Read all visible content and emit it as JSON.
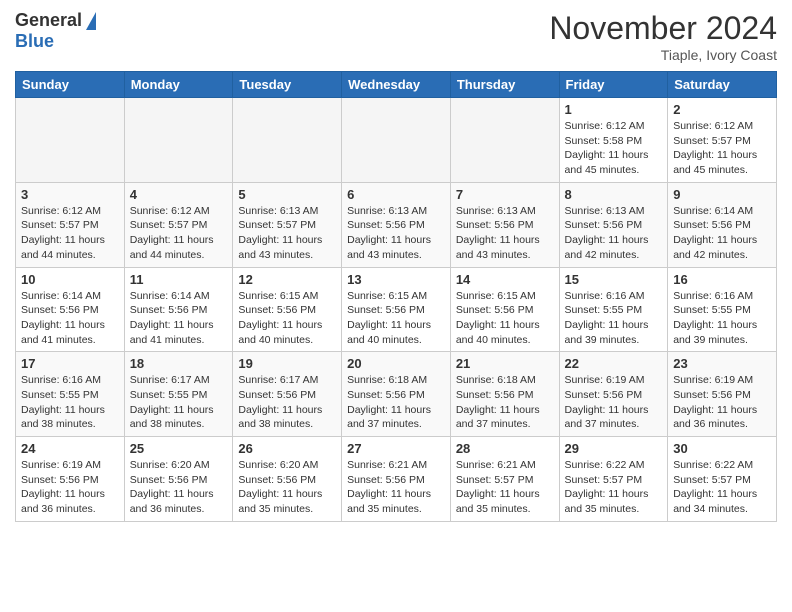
{
  "header": {
    "logo_general": "General",
    "logo_blue": "Blue",
    "month_title": "November 2024",
    "location": "Tiaple, Ivory Coast"
  },
  "weekdays": [
    "Sunday",
    "Monday",
    "Tuesday",
    "Wednesday",
    "Thursday",
    "Friday",
    "Saturday"
  ],
  "weeks": [
    [
      {
        "day": "",
        "info": ""
      },
      {
        "day": "",
        "info": ""
      },
      {
        "day": "",
        "info": ""
      },
      {
        "day": "",
        "info": ""
      },
      {
        "day": "",
        "info": ""
      },
      {
        "day": "1",
        "info": "Sunrise: 6:12 AM\nSunset: 5:58 PM\nDaylight: 11 hours and 45 minutes."
      },
      {
        "day": "2",
        "info": "Sunrise: 6:12 AM\nSunset: 5:57 PM\nDaylight: 11 hours and 45 minutes."
      }
    ],
    [
      {
        "day": "3",
        "info": "Sunrise: 6:12 AM\nSunset: 5:57 PM\nDaylight: 11 hours and 44 minutes."
      },
      {
        "day": "4",
        "info": "Sunrise: 6:12 AM\nSunset: 5:57 PM\nDaylight: 11 hours and 44 minutes."
      },
      {
        "day": "5",
        "info": "Sunrise: 6:13 AM\nSunset: 5:57 PM\nDaylight: 11 hours and 43 minutes."
      },
      {
        "day": "6",
        "info": "Sunrise: 6:13 AM\nSunset: 5:56 PM\nDaylight: 11 hours and 43 minutes."
      },
      {
        "day": "7",
        "info": "Sunrise: 6:13 AM\nSunset: 5:56 PM\nDaylight: 11 hours and 43 minutes."
      },
      {
        "day": "8",
        "info": "Sunrise: 6:13 AM\nSunset: 5:56 PM\nDaylight: 11 hours and 42 minutes."
      },
      {
        "day": "9",
        "info": "Sunrise: 6:14 AM\nSunset: 5:56 PM\nDaylight: 11 hours and 42 minutes."
      }
    ],
    [
      {
        "day": "10",
        "info": "Sunrise: 6:14 AM\nSunset: 5:56 PM\nDaylight: 11 hours and 41 minutes."
      },
      {
        "day": "11",
        "info": "Sunrise: 6:14 AM\nSunset: 5:56 PM\nDaylight: 11 hours and 41 minutes."
      },
      {
        "day": "12",
        "info": "Sunrise: 6:15 AM\nSunset: 5:56 PM\nDaylight: 11 hours and 40 minutes."
      },
      {
        "day": "13",
        "info": "Sunrise: 6:15 AM\nSunset: 5:56 PM\nDaylight: 11 hours and 40 minutes."
      },
      {
        "day": "14",
        "info": "Sunrise: 6:15 AM\nSunset: 5:56 PM\nDaylight: 11 hours and 40 minutes."
      },
      {
        "day": "15",
        "info": "Sunrise: 6:16 AM\nSunset: 5:55 PM\nDaylight: 11 hours and 39 minutes."
      },
      {
        "day": "16",
        "info": "Sunrise: 6:16 AM\nSunset: 5:55 PM\nDaylight: 11 hours and 39 minutes."
      }
    ],
    [
      {
        "day": "17",
        "info": "Sunrise: 6:16 AM\nSunset: 5:55 PM\nDaylight: 11 hours and 38 minutes."
      },
      {
        "day": "18",
        "info": "Sunrise: 6:17 AM\nSunset: 5:55 PM\nDaylight: 11 hours and 38 minutes."
      },
      {
        "day": "19",
        "info": "Sunrise: 6:17 AM\nSunset: 5:56 PM\nDaylight: 11 hours and 38 minutes."
      },
      {
        "day": "20",
        "info": "Sunrise: 6:18 AM\nSunset: 5:56 PM\nDaylight: 11 hours and 37 minutes."
      },
      {
        "day": "21",
        "info": "Sunrise: 6:18 AM\nSunset: 5:56 PM\nDaylight: 11 hours and 37 minutes."
      },
      {
        "day": "22",
        "info": "Sunrise: 6:19 AM\nSunset: 5:56 PM\nDaylight: 11 hours and 37 minutes."
      },
      {
        "day": "23",
        "info": "Sunrise: 6:19 AM\nSunset: 5:56 PM\nDaylight: 11 hours and 36 minutes."
      }
    ],
    [
      {
        "day": "24",
        "info": "Sunrise: 6:19 AM\nSunset: 5:56 PM\nDaylight: 11 hours and 36 minutes."
      },
      {
        "day": "25",
        "info": "Sunrise: 6:20 AM\nSunset: 5:56 PM\nDaylight: 11 hours and 36 minutes."
      },
      {
        "day": "26",
        "info": "Sunrise: 6:20 AM\nSunset: 5:56 PM\nDaylight: 11 hours and 35 minutes."
      },
      {
        "day": "27",
        "info": "Sunrise: 6:21 AM\nSunset: 5:56 PM\nDaylight: 11 hours and 35 minutes."
      },
      {
        "day": "28",
        "info": "Sunrise: 6:21 AM\nSunset: 5:57 PM\nDaylight: 11 hours and 35 minutes."
      },
      {
        "day": "29",
        "info": "Sunrise: 6:22 AM\nSunset: 5:57 PM\nDaylight: 11 hours and 35 minutes."
      },
      {
        "day": "30",
        "info": "Sunrise: 6:22 AM\nSunset: 5:57 PM\nDaylight: 11 hours and 34 minutes."
      }
    ]
  ]
}
